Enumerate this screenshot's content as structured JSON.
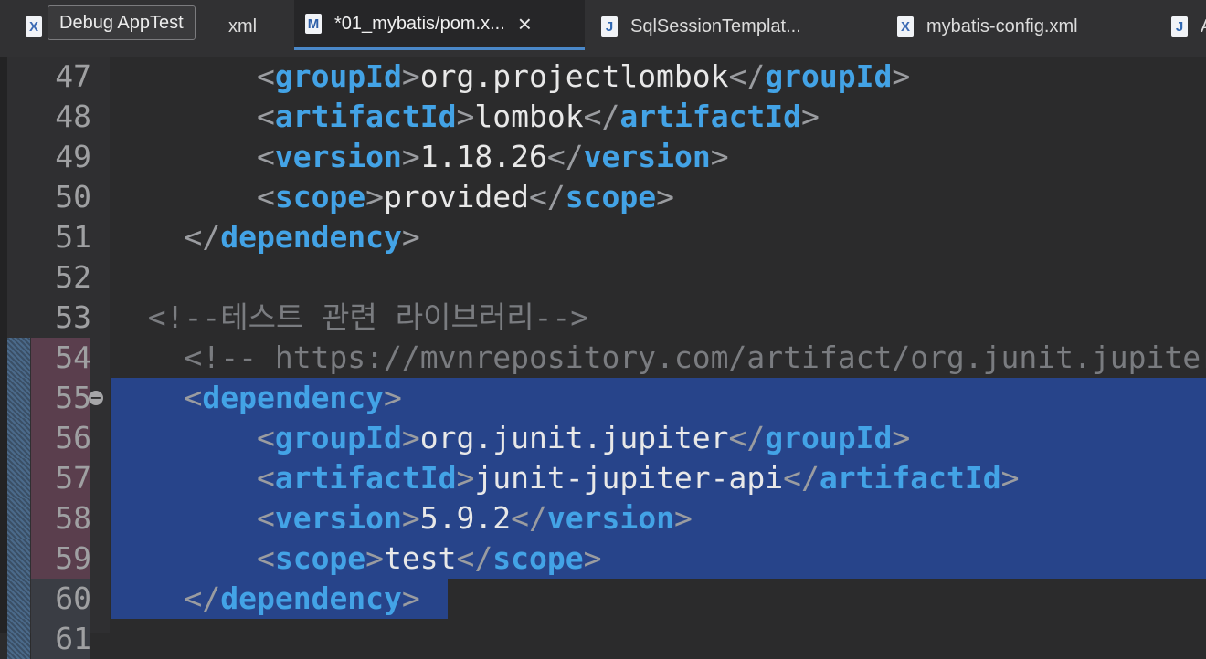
{
  "tooltip": "Debug AppTest",
  "tabs": [
    {
      "label": "xml",
      "icon": "xml-file-icon",
      "glyph": "X",
      "active": false
    },
    {
      "label": "*01_mybatis/pom.x...",
      "icon": "maven-file-icon",
      "glyph": "M",
      "active": true
    },
    {
      "label": "SqlSessionTemplat...",
      "icon": "java-file-icon",
      "glyph": "J",
      "active": false
    },
    {
      "label": "mybatis-config.xml",
      "icon": "xml-file-icon",
      "glyph": "X",
      "active": false
    },
    {
      "label": "A",
      "icon": "java-file-icon",
      "glyph": "J",
      "active": false
    }
  ],
  "editor": {
    "lines": [
      {
        "num": "47",
        "indent": "        ",
        "tag": "groupId",
        "text": "org.projectlombok"
      },
      {
        "num": "48",
        "indent": "        ",
        "tag": "artifactId",
        "text": "lombok"
      },
      {
        "num": "49",
        "indent": "        ",
        "tag": "version",
        "text": "1.18.26"
      },
      {
        "num": "50",
        "indent": "        ",
        "tag": "scope",
        "text": "provided"
      },
      {
        "num": "51",
        "indent": "    ",
        "close": "dependency"
      },
      {
        "num": "52"
      },
      {
        "num": "53",
        "indent": "  ",
        "comment": "<!--테스트 관련 라이브러리-->"
      },
      {
        "num": "54",
        "indent": "    ",
        "comment": "<!-- https://mvnrepository.com/artifact/org.junit.jupiter",
        "changed": true
      },
      {
        "num": "55",
        "indent": "    ",
        "open": "dependency",
        "changed": true,
        "selected": true,
        "fold": true
      },
      {
        "num": "56",
        "indent": "        ",
        "tag": "groupId",
        "text": "org.junit.jupiter",
        "changed": true,
        "selected": true
      },
      {
        "num": "57",
        "indent": "        ",
        "tag": "artifactId",
        "text": "junit-jupiter-api",
        "changed": true,
        "selected": true
      },
      {
        "num": "58",
        "indent": "        ",
        "tag": "version",
        "text": "5.9.2",
        "changed": true,
        "selected": true
      },
      {
        "num": "59",
        "indent": "        ",
        "tag": "scope",
        "text": "test",
        "changed": true,
        "selected": true
      },
      {
        "num": "60",
        "indent": "    ",
        "close": "dependency",
        "changed": true,
        "selected": true,
        "partial": true
      },
      {
        "num": "61",
        "changed": true
      }
    ]
  },
  "colors": {
    "tag": "#43a3e6",
    "bracket": "#9a9ca0",
    "text": "#e8e8e8",
    "comment": "#7a7c80",
    "selection": "#27448a"
  }
}
